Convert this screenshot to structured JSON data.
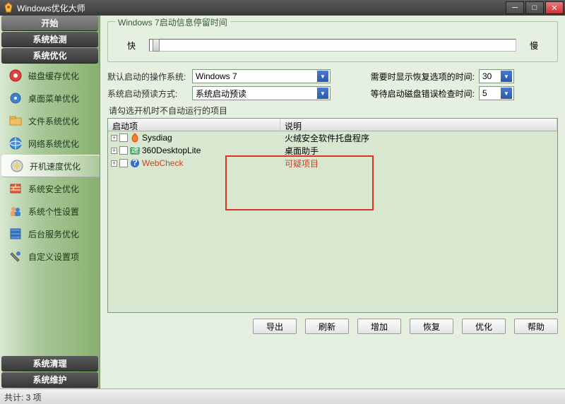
{
  "title": "Windows优化大师",
  "sidebar": {
    "top_tabs": [
      "开始",
      "系统检测",
      "系统优化"
    ],
    "items": [
      {
        "label": "磁盘缓存优化"
      },
      {
        "label": "桌面菜单优化"
      },
      {
        "label": "文件系统优化"
      },
      {
        "label": "网络系统优化"
      },
      {
        "label": "开机速度优化"
      },
      {
        "label": "系统安全优化"
      },
      {
        "label": "系统个性设置"
      },
      {
        "label": "后台服务优化"
      },
      {
        "label": "自定义设置项"
      }
    ],
    "bottom_tabs": [
      "系统清理",
      "系统维护"
    ]
  },
  "panel": {
    "group_title": "Windows 7启动信息停留时间",
    "slider_fast": "快",
    "slider_slow": "慢",
    "default_os_label": "默认启动的操作系统:",
    "default_os_value": "Windows 7",
    "preview_label": "系统启动预读方式:",
    "preview_value": "系统启动预读",
    "restore_time_label": "需要时显示恢复选项的时间:",
    "restore_time_value": "30",
    "disk_check_label": "等待启动磁盘错误检查时间:",
    "disk_check_value": "5",
    "instruction": "请勾选开机时不自动运行的项目",
    "col_name": "启动项",
    "col_desc": "说明",
    "rows": [
      {
        "name": "Sysdiag",
        "desc": "火绒安全软件托盘程序",
        "suspicious": false
      },
      {
        "name": "360DesktopLite",
        "desc": "桌面助手",
        "suspicious": false
      },
      {
        "name": "WebCheck",
        "desc": "可疑项目",
        "suspicious": true
      }
    ],
    "buttons": [
      "导出",
      "刷新",
      "增加",
      "恢复",
      "优化",
      "帮助"
    ]
  },
  "status": "共计: 3 项"
}
